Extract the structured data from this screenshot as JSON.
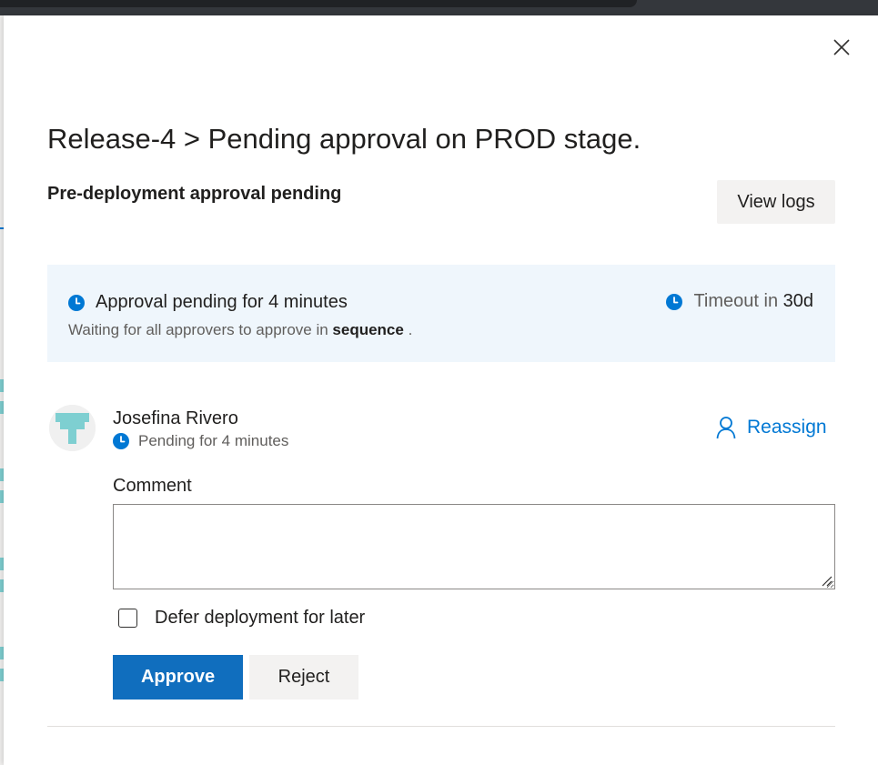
{
  "dialog": {
    "title": "Release-4 > Pending approval on PROD stage.",
    "subtitle": "Pre-deployment approval pending",
    "view_logs_label": "View logs",
    "close_icon": "close-icon"
  },
  "status": {
    "pending_text": "Approval pending for 4 minutes",
    "timeout_prefix": "Timeout in ",
    "timeout_value": "30d",
    "waiting_prefix": "Waiting for all approvers to approve in ",
    "waiting_mode": "sequence",
    "waiting_suffix": " .",
    "clock_icon": "clock-icon"
  },
  "approver": {
    "name": "Josefina Rivero",
    "status": "Pending for 4 minutes",
    "reassign_label": "Reassign",
    "reassign_icon": "person-icon"
  },
  "form": {
    "comment_label": "Comment",
    "comment_value": "",
    "defer_label": "Defer deployment for later",
    "defer_checked": false,
    "approve_label": "Approve",
    "reject_label": "Reject"
  },
  "colors": {
    "accent": "#0078d4",
    "approve_bg": "#106ebe",
    "info_bg": "#eff6fc",
    "avatar_tile": "#7ecfd1"
  }
}
